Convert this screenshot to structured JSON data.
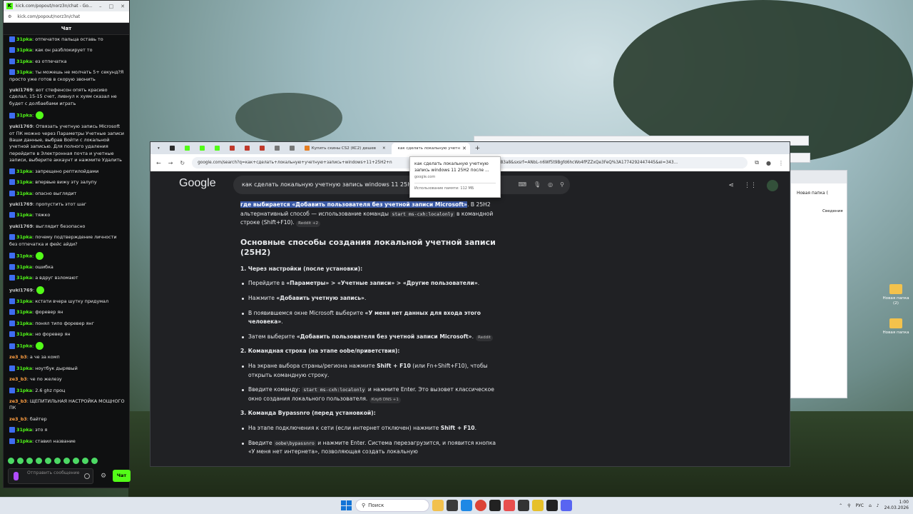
{
  "chat_window": {
    "title": "kick.com/popout/norz3n/chat - Go...",
    "url": "kick.com/popout/norz3n/chat",
    "header": "Чат",
    "messages": [
      {
        "user": "31pka",
        "text": ": отпечаток пальца оставь то",
        "color": "green",
        "badge": true
      },
      {
        "user": "31pka",
        "text": ": как он разблокирует то",
        "color": "green",
        "badge": true
      },
      {
        "user": "31pka",
        "text": ": ез отпечатка",
        "color": "green",
        "badge": true
      },
      {
        "user": "31pka",
        "text": ": ты можешь не молчать 5+ секунд?Я просто уже готов в скорую звонить",
        "color": "green",
        "badge": true
      },
      {
        "user": "yuki1769",
        "text": ": вот стефенсон опять красиво сделал, 15-15 счет, ливнул к хуям сказал не будет с долбаебами играть",
        "color": "grey",
        "badge": false
      },
      {
        "user": "31pka",
        "text": ":",
        "color": "green",
        "badge": true,
        "emote": true
      },
      {
        "user": "yuki1769",
        "text": ": Отвязать учетную запись Microsoft от ПК можно через Параметры Учетные записи Ваши данные, выбрав Войти с локальной учетной записью. Для полного удаления перейдите в Электронная почта и учетные записи, выберите аккаунт и нажмите Удалить",
        "color": "grey",
        "badge": false
      },
      {
        "user": "31pka",
        "text": ": запрещено рептилойдами",
        "color": "green",
        "badge": true
      },
      {
        "user": "31pka",
        "text": ": впервые вижу эту залупу",
        "color": "green",
        "badge": true
      },
      {
        "user": "31pka",
        "text": ": опасно выглядит",
        "color": "green",
        "badge": true
      },
      {
        "user": "yuki1769",
        "text": ": пропустить этот шаг",
        "color": "grey",
        "badge": false
      },
      {
        "user": "31pka",
        "text": ": тяжко",
        "color": "green",
        "badge": true
      },
      {
        "user": "yuki1769",
        "text": ": выглядит безопасно",
        "color": "grey",
        "badge": false
      },
      {
        "user": "31pka",
        "text": ": почему подтверждение личности без отпечатка и фейс айди?",
        "color": "green",
        "badge": true
      },
      {
        "user": "31pka",
        "text": ":",
        "color": "green",
        "badge": true,
        "emote": true
      },
      {
        "user": "31pka",
        "text": ": ошибка",
        "color": "green",
        "badge": true
      },
      {
        "user": "31pka",
        "text": ": а вдруг взломают",
        "color": "green",
        "badge": true
      },
      {
        "user": "yuki1769",
        "text": ":",
        "color": "grey",
        "badge": false,
        "emote": true
      },
      {
        "user": "31pka",
        "text": ": кстати вчера шутку придумал",
        "color": "green",
        "badge": true
      },
      {
        "user": "31pka",
        "text": ": форевер ян",
        "color": "green",
        "badge": true
      },
      {
        "user": "31pka",
        "text": ": понял типо форевер янг",
        "color": "green",
        "badge": true
      },
      {
        "user": "31pka",
        "text": ": но форевер ян",
        "color": "green",
        "badge": true
      },
      {
        "user": "31pka",
        "text": ":",
        "color": "green",
        "badge": true,
        "emote": true
      },
      {
        "user": "ze3_b3",
        "text": ": а че за комп",
        "color": "orange",
        "badge": false
      },
      {
        "user": "31pka",
        "text": ": ноутбук дырявый",
        "color": "green",
        "badge": true
      },
      {
        "user": "ze3_b3",
        "text": ": че по железу",
        "color": "orange",
        "badge": false
      },
      {
        "user": "31pka",
        "text": ": 2.6 ghz проц",
        "color": "green",
        "badge": true
      },
      {
        "user": "ze3_b3",
        "text": ": ЩЕПИТИЛЬНАЯ НАСТРОЙКА МОЩНОГО ПК",
        "color": "orange",
        "badge": false
      },
      {
        "user": "ze3_b3",
        "text": ": байтер",
        "color": "orange",
        "badge": false
      },
      {
        "user": "31pka",
        "text": ": это я",
        "color": "green",
        "badge": true
      },
      {
        "user": "31pka",
        "text": ": ставил название",
        "color": "green",
        "badge": true
      }
    ],
    "input_placeholder": "Отправить сообщение",
    "send_label": "Чат"
  },
  "browser": {
    "tabs": [
      {
        "label": "",
        "fav": "#2d2d2d"
      },
      {
        "label": "",
        "fav": "#53fc18"
      },
      {
        "label": "",
        "fav": "#53fc18"
      },
      {
        "label": "",
        "fav": "#53fc18"
      },
      {
        "label": "",
        "fav": "#c0392b"
      },
      {
        "label": "",
        "fav": "#c0392b"
      },
      {
        "label": "",
        "fav": "#c0392b"
      },
      {
        "label": "",
        "fav": "#777777"
      },
      {
        "label": "",
        "fav": "#777777"
      },
      {
        "label": "Купить скины CS2 (KC2) дешев",
        "fav": "#e67e22"
      }
    ],
    "active_tab": "как сделать локальную учетн",
    "url": "google.com/search?q=как+сделать+локальную+учетную+запись+windows+11+25H2+n",
    "url_tail": "83a8&sxsrf=ANbL-n6Wf5t9Bgfd6hcWo4fPZZxQe3FeQ%3A1774292447445&ei=343...",
    "search_query": "как сделать локальную учетную запись windows 11 25H2 п",
    "tooltip": {
      "title": "как сделать локальную учетную запись windows 11 25H2 после ...",
      "domain": "google.com",
      "memory": "Использование памяти: 112 МБ"
    }
  },
  "article": {
    "intro_highlight": "где выбирается «Добавить пользователя без учетной записи Microsoft»",
    "intro_rest_1": ". В 25H2 альтернативный способ — использование команды",
    "intro_code": "start ms-cxh:localonly",
    "intro_rest_2": "в командной строке (Shift+F10).",
    "intro_src": "Reddit +2",
    "h2": "Основные способы создания локальной учетной записи (25H2)",
    "s1_title": "1. Через настройки (после установки):",
    "s1_items": [
      {
        "pre": "Перейдите в ",
        "bold": "«Параметры» > «Учетные записи» > «Другие пользователи»",
        "post": "."
      },
      {
        "pre": "Нажмите ",
        "bold": "«Добавить учетную запись»",
        "post": "."
      },
      {
        "pre": "В появившемся окне Microsoft выберите ",
        "bold": "«У меня нет данных для входа этого человека»",
        "post": "."
      },
      {
        "pre": "Затем выберите ",
        "bold": "«Добавить пользователя без учетной записи Microsoft»",
        "post": ".",
        "src": "Reddit"
      }
    ],
    "s2_title": "2. Командная строка (на этапе oobe/приветствия):",
    "s2_item1_pre": "На экране выбора страны/региона нажмите ",
    "s2_item1_bold": "Shift + F10",
    "s2_item1_post": " (или Fn+Shift+F10), чтобы открыть командную строку.",
    "s2_item2_pre": "Введите команду: ",
    "s2_item2_code": "start ms-cxh:localonly",
    "s2_item2_post": " и нажмите Enter. Это вызовет классическое окно создания локального пользователя.",
    "s2_item2_src": "Клуб DNS +1",
    "s3_title": "3. Команда Bypassnro (перед установкой):",
    "s3_item1_pre": "На этапе подключения к сети (если интернет отключен) нажмите ",
    "s3_item1_bold": "Shift + F10",
    "s3_item1_post": ".",
    "s3_item2_pre": "Введите ",
    "s3_item2_code": "oobe\\bypassnro",
    "s3_item2_post": " и нажмите Enter. Система перезагрузится, и появится кнопка «У меня нет интернета», позволяющая создать локальную"
  },
  "explorer": {
    "tab": "Новая папка (",
    "item": "Сведения"
  },
  "desktop_icons": [
    {
      "label": "Новая папка (2)"
    },
    {
      "label": "Новая папка"
    }
  ],
  "taskbar": {
    "search_placeholder": "Поиск",
    "lang": "РУС",
    "time": "1:00",
    "date": "24.03.2026"
  },
  "colors": {
    "kick_green": "#53fc18",
    "chat_bg": "#0f1011",
    "google_bg": "#202124",
    "highlight": "#3b5aa6"
  }
}
